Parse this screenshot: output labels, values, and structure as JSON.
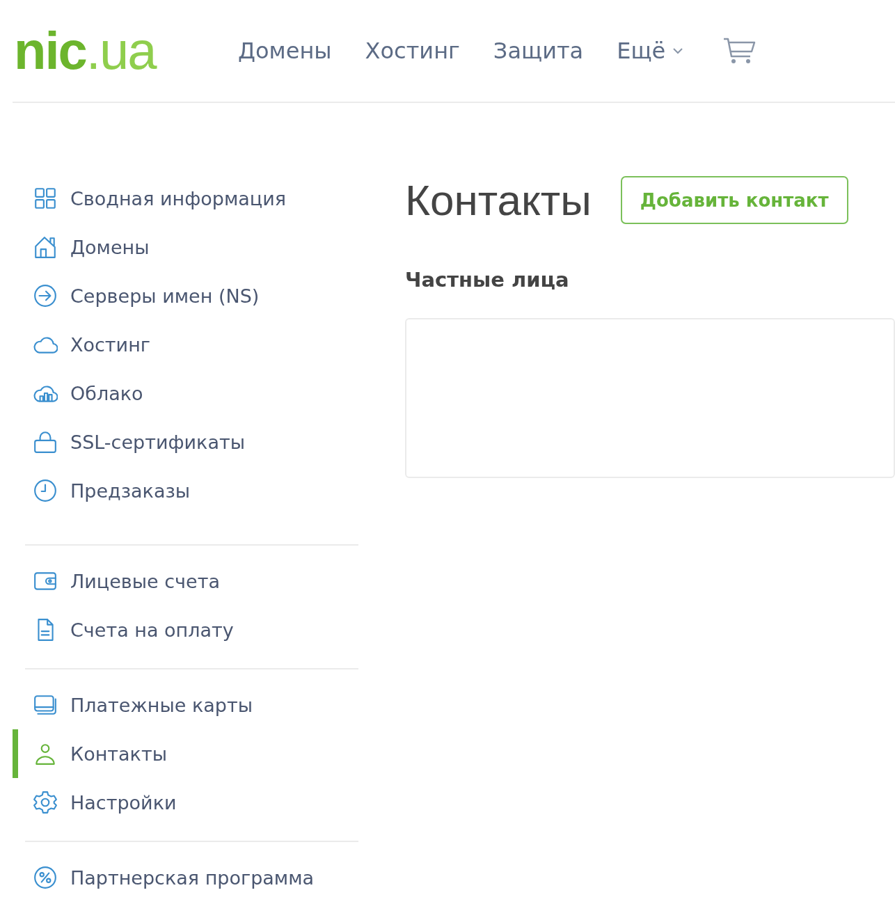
{
  "logo": {
    "name": "nic",
    "tld": ".ua"
  },
  "nav": [
    {
      "label": "Домены",
      "dropdown": false
    },
    {
      "label": "Хостинг",
      "dropdown": false
    },
    {
      "label": "Защита",
      "dropdown": false
    },
    {
      "label": "Ещё",
      "dropdown": true
    }
  ],
  "sidebar": {
    "groups": [
      {
        "items": [
          {
            "label": "Сводная информация",
            "selected": false
          },
          {
            "label": "Домены",
            "selected": false
          },
          {
            "label": "Серверы имен (NS)",
            "selected": false
          },
          {
            "label": "Хостинг",
            "selected": false
          },
          {
            "label": "Облако",
            "selected": false
          },
          {
            "label": "SSL-сертификаты",
            "selected": false
          },
          {
            "label": "Предзаказы",
            "selected": false
          }
        ]
      },
      {
        "items": [
          {
            "label": "Лицевые счета",
            "selected": false
          },
          {
            "label": "Счета на оплату",
            "selected": false
          }
        ]
      },
      {
        "items": [
          {
            "label": "Платежные карты",
            "selected": false
          },
          {
            "label": "Контакты",
            "selected": true
          },
          {
            "label": "Настройки",
            "selected": false
          }
        ]
      },
      {
        "items": [
          {
            "label": "Партнерская программа",
            "selected": false
          }
        ]
      }
    ]
  },
  "page": {
    "title": "Контакты",
    "add_button": "Добавить контакт",
    "sections": [
      {
        "heading": "Частные лица"
      }
    ]
  }
}
